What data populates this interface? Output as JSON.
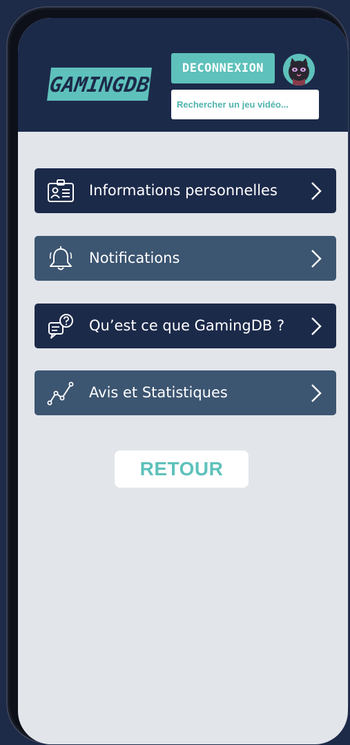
{
  "app": {
    "logo_text": "GAMINGDB",
    "brand_color": "#5ec1bb",
    "header_color": "#1c2a4a"
  },
  "header": {
    "logout_label": "DECONNEXION",
    "search_placeholder": "Rechercher un jeu vidéo...",
    "avatar_icon": "cat-avatar-icon"
  },
  "menu": {
    "items": [
      {
        "label": "Informations personnelles",
        "icon": "id-card-icon",
        "style": "dark"
      },
      {
        "label": "Notifications",
        "icon": "bell-icon",
        "style": "light"
      },
      {
        "label": "Qu’est ce que GamingDB ?",
        "icon": "question-chat-icon",
        "style": "dark"
      },
      {
        "label": "Avis et Statistiques",
        "icon": "line-chart-icon",
        "style": "light"
      }
    ],
    "chevron_icon": "chevron-right-icon"
  },
  "footer": {
    "back_label": "RETOUR"
  }
}
